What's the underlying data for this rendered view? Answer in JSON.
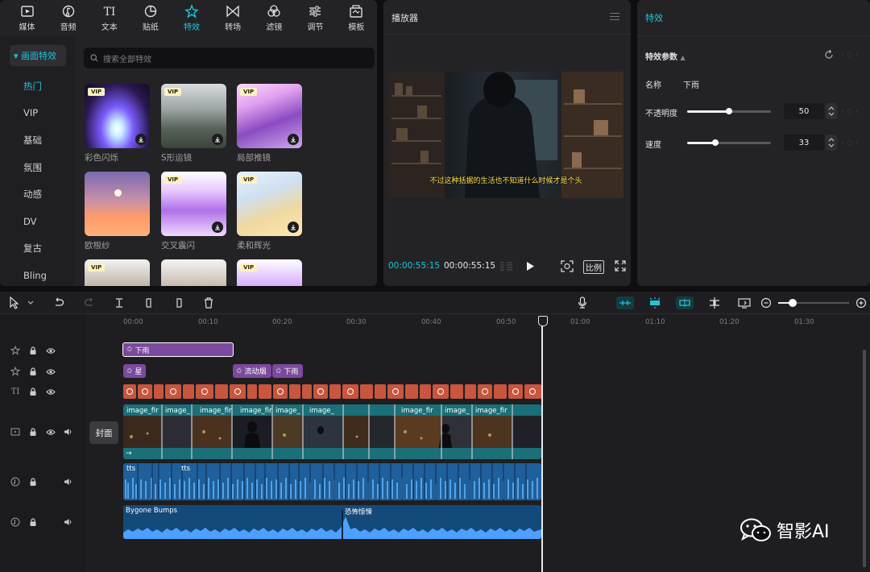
{
  "library": {
    "categories": [
      {
        "label": "媒体",
        "icon": "media-icon"
      },
      {
        "label": "音频",
        "icon": "audio-icon"
      },
      {
        "label": "文本",
        "icon": "text-icon"
      },
      {
        "label": "贴纸",
        "icon": "sticker-icon"
      },
      {
        "label": "特效",
        "icon": "effects-icon",
        "active": true
      },
      {
        "label": "转场",
        "icon": "transition-icon"
      },
      {
        "label": "滤镜",
        "icon": "filter-icon"
      },
      {
        "label": "调节",
        "icon": "adjust-icon"
      },
      {
        "label": "模板",
        "icon": "template-icon"
      }
    ],
    "side_header": "画面特效",
    "side_items": [
      "热门",
      "VIP",
      "基础",
      "氛围",
      "动感",
      "DV",
      "复古",
      "Bling"
    ],
    "search_placeholder": "搜索全部特效",
    "vip_badge": "VIP",
    "effects": [
      {
        "name": "彩色闪烁",
        "vip": true,
        "download": true
      },
      {
        "name": "S形运镜",
        "vip": true,
        "download": true
      },
      {
        "name": "局部推镜",
        "vip": true,
        "download": true
      },
      {
        "name": "欧根纱",
        "vip": false,
        "download": false
      },
      {
        "name": "交叉震闪",
        "vip": true,
        "download": true
      },
      {
        "name": "柔和辉光",
        "vip": true,
        "download": true
      },
      {
        "name": "",
        "vip": true,
        "download": false
      },
      {
        "name": "",
        "vip": false,
        "download": false
      },
      {
        "name": "",
        "vip": true,
        "download": false
      }
    ]
  },
  "player": {
    "title": "播放器",
    "subtitle": "不过这种括据的生活也不知道什么时候才是个头",
    "current_time": "00:00:55:15",
    "total_time": "00:00:55:15",
    "ratio_label": "比例"
  },
  "effect_panel": {
    "title": "特效",
    "section": "特效参数",
    "name_label": "名称",
    "name_value": "下雨",
    "params": [
      {
        "label": "不透明度",
        "value": "50",
        "fraction": 0.5
      },
      {
        "label": "速度",
        "value": "33",
        "fraction": 0.33
      }
    ]
  },
  "timeline": {
    "ruler": [
      "00:00",
      "00:10",
      "00:20",
      "00:30",
      "00:40",
      "00:50",
      "01:00",
      "01:10",
      "01:20",
      "01:30"
    ],
    "cover_label": "封面",
    "effect_clips": [
      {
        "label": "下雨"
      },
      {
        "label": "星"
      },
      {
        "label": "流动烟"
      },
      {
        "label": "下雨"
      }
    ],
    "video_clip_label": "image_fir",
    "video_clip_label_short": "image_",
    "audio_tts_label": "tts",
    "music": [
      {
        "label": "Bygone Bumps"
      },
      {
        "label": "恐怖惊悚"
      }
    ]
  },
  "watermark": {
    "text": "智影AI"
  },
  "colors": {
    "accent": "#20c5d8",
    "effect_clip": "#7b4a9c",
    "text_clip": "#c8553d",
    "video_clip": "#1a6f78",
    "audio_clip": "#1f5f9a"
  }
}
